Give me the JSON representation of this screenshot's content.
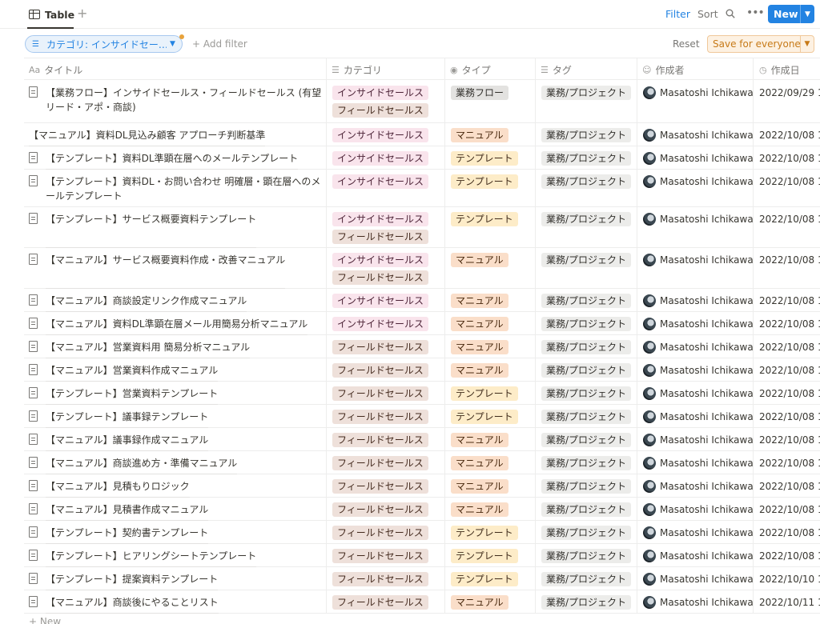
{
  "view": {
    "label": "Table",
    "add": "+"
  },
  "toolbar": {
    "filter": "Filter",
    "sort": "Sort",
    "more": "•••",
    "new": "New"
  },
  "filterbar": {
    "pill": "カテゴリ: インサイドセー…",
    "add_filter": "Add filter",
    "reset": "Reset",
    "save": "Save for everyone"
  },
  "columns": {
    "title": "タイトル",
    "title_icon": "Aa",
    "category": "カテゴリ",
    "type": "タイプ",
    "tag": "タグ",
    "author": "作成者",
    "created": "作成日"
  },
  "colors": {
    "accent": "#2383e2",
    "save_orange": "#c77a18",
    "tag_pink": "#f9e4ec",
    "tag_brown": "#eee0da",
    "tag_orange": "#fadec9",
    "tag_yellow": "#fdecc8",
    "tag_gray": "#e3e2e0"
  },
  "rows": [
    {
      "title": "【業務フロー】インサイドセールス・フィールドセールス (有望リード・アポ・商談)",
      "icon": "page-icon",
      "categories": [
        "インサイドセールス",
        "フィールドセールス"
      ],
      "type": "業務フロー",
      "tag": "業務/プロジェクト",
      "author": "Masatoshi Ichikawa",
      "created": "2022/09/29 1"
    },
    {
      "title": "【マニュアル】資料DL見込み顧客 アプローチ判断基準",
      "icon": "none",
      "categories": [
        "インサイドセールス"
      ],
      "type": "マニュアル",
      "tag": "業務/プロジェクト",
      "author": "Masatoshi Ichikawa",
      "created": "2022/10/08 1"
    },
    {
      "title": "【テンプレート】資料DL準顕在層へのメールテンプレート",
      "icon": "page-icon",
      "categories": [
        "インサイドセールス"
      ],
      "type": "テンプレート",
      "tag": "業務/プロジェクト",
      "author": "Masatoshi Ichikawa",
      "created": "2022/10/08 1"
    },
    {
      "title": "【テンプレート】資料DL・お問い合わせ 明確層・顕在層へのメールテンプレート",
      "icon": "page-icon",
      "categories": [
        "インサイドセールス"
      ],
      "type": "テンプレート",
      "tag": "業務/プロジェクト",
      "author": "Masatoshi Ichikawa",
      "created": "2022/10/08 1"
    },
    {
      "title": "【テンプレート】サービス概要資料テンプレート",
      "icon": "page-icon",
      "categories": [
        "インサイドセールス",
        "フィールドセールス"
      ],
      "type": "テンプレート",
      "tag": "業務/プロジェクト",
      "author": "Masatoshi Ichikawa",
      "created": "2022/10/08 1"
    },
    {
      "title": "【マニュアル】サービス概要資料作成・改善マニュアル",
      "icon": "page-icon",
      "categories": [
        "インサイドセールス",
        "フィールドセールス"
      ],
      "type": "マニュアル",
      "tag": "業務/プロジェクト",
      "author": "Masatoshi Ichikawa",
      "created": "2022/10/08 1"
    },
    {
      "title": "【マニュアル】商談設定リンク作成マニュアル",
      "icon": "page-icon",
      "categories": [
        "インサイドセールス"
      ],
      "type": "マニュアル",
      "tag": "業務/プロジェクト",
      "author": "Masatoshi Ichikawa",
      "created": "2022/10/08 1"
    },
    {
      "title": "【マニュアル】資料DL準顕在層メール用簡易分析マニュアル",
      "icon": "page-icon",
      "categories": [
        "インサイドセールス"
      ],
      "type": "マニュアル",
      "tag": "業務/プロジェクト",
      "author": "Masatoshi Ichikawa",
      "created": "2022/10/08 1"
    },
    {
      "title": "【マニュアル】営業資料用 簡易分析マニュアル",
      "icon": "page-icon",
      "categories": [
        "フィールドセールス"
      ],
      "type": "マニュアル",
      "tag": "業務/プロジェクト",
      "author": "Masatoshi Ichikawa",
      "created": "2022/10/08 1"
    },
    {
      "title": "【マニュアル】営業資料作成マニュアル",
      "icon": "page-icon",
      "categories": [
        "フィールドセールス"
      ],
      "type": "マニュアル",
      "tag": "業務/プロジェクト",
      "author": "Masatoshi Ichikawa",
      "created": "2022/10/08 1"
    },
    {
      "title": "【テンプレート】営業資料テンプレート",
      "icon": "page-icon",
      "categories": [
        "フィールドセールス"
      ],
      "type": "テンプレート",
      "tag": "業務/プロジェクト",
      "author": "Masatoshi Ichikawa",
      "created": "2022/10/08 1"
    },
    {
      "title": "【テンプレート】議事録テンプレート",
      "icon": "page-icon",
      "categories": [
        "フィールドセールス"
      ],
      "type": "テンプレート",
      "tag": "業務/プロジェクト",
      "author": "Masatoshi Ichikawa",
      "created": "2022/10/08 1"
    },
    {
      "title": "【マニュアル】議事録作成マニュアル",
      "icon": "page-icon",
      "categories": [
        "フィールドセールス"
      ],
      "type": "マニュアル",
      "tag": "業務/プロジェクト",
      "author": "Masatoshi Ichikawa",
      "created": "2022/10/08 1"
    },
    {
      "title": "【マニュアル】商談進め方・準備マニュアル",
      "icon": "page-icon",
      "categories": [
        "フィールドセールス"
      ],
      "type": "マニュアル",
      "tag": "業務/プロジェクト",
      "author": "Masatoshi Ichikawa",
      "created": "2022/10/08 1"
    },
    {
      "title": "【マニュアル】見積もりロジック",
      "icon": "page-icon",
      "categories": [
        "フィールドセールス"
      ],
      "type": "マニュアル",
      "tag": "業務/プロジェクト",
      "author": "Masatoshi Ichikawa",
      "created": "2022/10/08 1"
    },
    {
      "title": "【マニュアル】見積書作成マニュアル",
      "icon": "page-icon",
      "categories": [
        "フィールドセールス"
      ],
      "type": "マニュアル",
      "tag": "業務/プロジェクト",
      "author": "Masatoshi Ichikawa",
      "created": "2022/10/08 1"
    },
    {
      "title": "【テンプレート】契約書テンプレート",
      "icon": "page-icon",
      "categories": [
        "フィールドセールス"
      ],
      "type": "テンプレート",
      "tag": "業務/プロジェクト",
      "author": "Masatoshi Ichikawa",
      "created": "2022/10/08 1"
    },
    {
      "title": "【テンプレート】ヒアリングシートテンプレート",
      "icon": "page-icon",
      "categories": [
        "フィールドセールス"
      ],
      "type": "テンプレート",
      "tag": "業務/プロジェクト",
      "author": "Masatoshi Ichikawa",
      "created": "2022/10/08 1"
    },
    {
      "title": "【テンプレート】提案資料テンプレート",
      "icon": "page-icon",
      "categories": [
        "フィールドセールス"
      ],
      "type": "テンプレート",
      "tag": "業務/プロジェクト",
      "author": "Masatoshi Ichikawa",
      "created": "2022/10/10 1"
    },
    {
      "title": "【マニュアル】商談後にやることリスト",
      "icon": "page-icon",
      "categories": [
        "フィールドセールス"
      ],
      "type": "マニュアル",
      "tag": "業務/プロジェクト",
      "author": "Masatoshi Ichikawa",
      "created": "2022/10/11 1"
    }
  ],
  "footer": {
    "new_row": "+ New"
  }
}
